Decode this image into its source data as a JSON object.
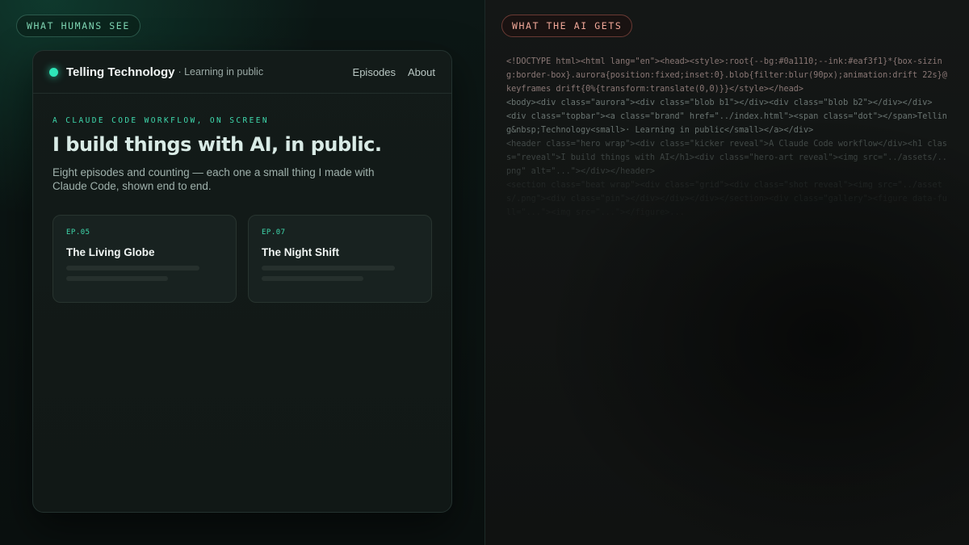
{
  "left_panel": {
    "label": "WHAT HUMANS SEE",
    "site": {
      "brand": "Telling Technology",
      "brand_sub": "· Learning in public",
      "nav": [
        "Episodes",
        "About"
      ],
      "kicker": "A CLAUDE CODE WORKFLOW, ON SCREEN",
      "title": "I build things with AI, in public.",
      "description": "Eight episodes and counting — each one a small thing I made with Claude Code, shown end to end.",
      "episodes": [
        {
          "number": "EP.05",
          "title": "The Living Globe"
        },
        {
          "number": "EP.07",
          "title": "The Night Shift"
        }
      ]
    }
  },
  "right_panel": {
    "label": "WHAT THE AI GETS",
    "code_lines": [
      "<!DOCTYPE html><html lang=\"en\"><head><style>:root{--bg:#0a1110;--ink:#eaf3f1}*{box-sizing:border-box}.aurora{position:fixed;inset:0}.blob{filter:blur(90px);animation:drift 22s}@keyframes drift{0%{transform:translate(0,0)}}</style></head>",
      "<body><div class=\"aurora\"><div class=\"blob b1\"></div><div class=\"blob b2\"></div></div>",
      "<div class=\"topbar\"><a class=\"brand\" href=\"../index.html\"><span class=\"dot\"></span>Telling&nbsp;Technology<small>· Learning in public</small></a></div>",
      "<header class=\"hero wrap\"><div class=\"kicker reveal\">A Claude Code workflow</div><h1 class=\"reveal\">I build things with AI</h1><div class=\"hero-art reveal\"><img src=\"../assets/..png\" alt=\"...\"></div></header>",
      "<section class=\"beat wrap\"><div class=\"grid\"><div class=\"shot reveal\"><img src=\"../assets/.png\"><div class=\"pin\"></div></div></div></section><div class=\"gallery\"><figure data-full=\"...\"><img src=\"...\"></figure>..."
    ]
  },
  "colors": {
    "accent": "#2ee6b8",
    "left_label": "#7fd6b4",
    "right_label": "#f2a899"
  }
}
